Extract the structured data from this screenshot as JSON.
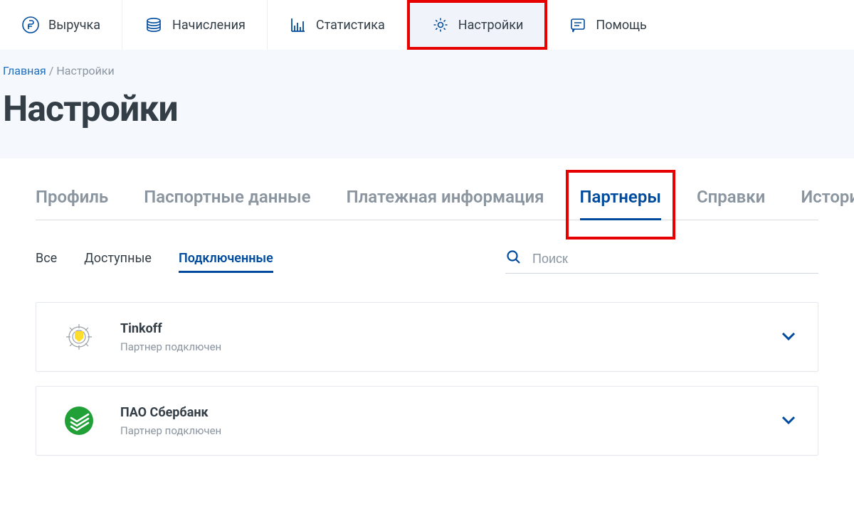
{
  "topnav": {
    "items": [
      {
        "id": "revenue",
        "label": "Выручка"
      },
      {
        "id": "accruals",
        "label": "Начисления"
      },
      {
        "id": "stats",
        "label": "Статистика"
      },
      {
        "id": "settings",
        "label": "Настройки",
        "active": true,
        "highlighted": true
      },
      {
        "id": "help",
        "label": "Помощь"
      }
    ]
  },
  "breadcrumb": {
    "home": "Главная",
    "separator": "/",
    "current": "Настройки"
  },
  "page_title": "Настройки",
  "tabs": [
    {
      "id": "profile",
      "label": "Профиль"
    },
    {
      "id": "passport",
      "label": "Паспортные данные"
    },
    {
      "id": "payment",
      "label": "Платежная информация"
    },
    {
      "id": "partners",
      "label": "Партнеры",
      "active": true,
      "highlighted": true
    },
    {
      "id": "docs",
      "label": "Справки"
    },
    {
      "id": "history",
      "label": "История"
    }
  ],
  "filters": [
    {
      "id": "all",
      "label": "Все"
    },
    {
      "id": "available",
      "label": "Доступные"
    },
    {
      "id": "connected",
      "label": "Подключенные",
      "active": true
    }
  ],
  "search": {
    "placeholder": "Поиск"
  },
  "partners": [
    {
      "name": "Tinkoff",
      "status": "Партнер подключен"
    },
    {
      "name": "ПАО Сбербанк",
      "status": "Партнер подключен"
    }
  ],
  "colors": {
    "primary": "#004b9d",
    "muted": "#8a95a0",
    "text": "#343e47",
    "highlight": "#e60000",
    "bg_header": "#f5f8fc"
  }
}
